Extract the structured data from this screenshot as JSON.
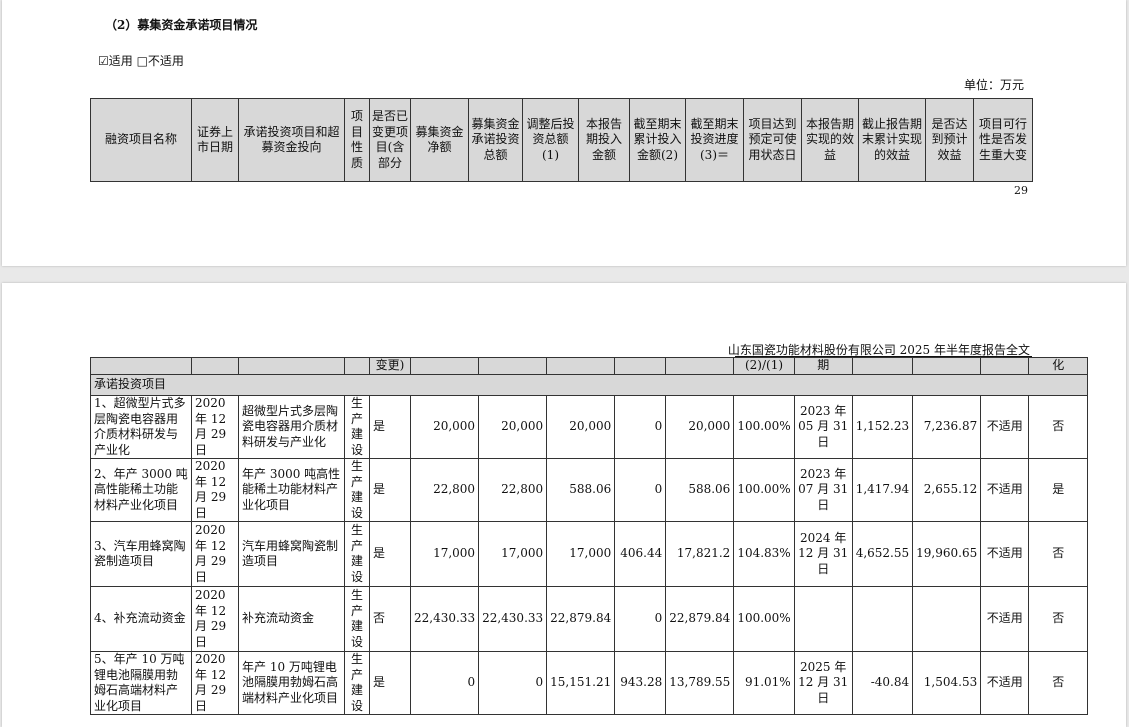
{
  "page1": {
    "section_title": "（2）募集资金承诺项目情况",
    "apply_option": "☑适用 □不适用",
    "unit": "单位：万元",
    "page_number": "29",
    "headers": [
      "融资项目名称",
      "证券上市日期",
      "承诺投资项目和超募资金投向",
      "项目性质",
      "是否已变更项目(含部分",
      "募集资金净额",
      "募集资金承诺投资总额",
      "调整后投资总额(1)",
      "本报告期投入金额",
      "截至期末累计投入金额(2)",
      "截至期末投资进度(3)＝",
      "项目达到预定可使用状态日",
      "本报告期实现的效益",
      "截止报告期末累计实现的效益",
      "是否达到预计效益",
      "项目可行性是否发生重大变"
    ]
  },
  "page2": {
    "report_title": "山东国瓷功能材料股份有限公司 2025 年半年度报告全文",
    "continued": [
      "",
      "",
      "",
      "",
      "变更)",
      "",
      "",
      "",
      "",
      "",
      "(2)/(1)",
      "期",
      "",
      "",
      "",
      "化"
    ],
    "category": "承诺投资项目",
    "rows": [
      {
        "name": "1、超微型片式多层陶瓷电容器用介质材料研发与产业化",
        "date": "2020 年 12 月 29 日",
        "project": "超微型片式多层陶瓷电容器用介质材料研发与产业化",
        "nature": "生产建设",
        "changed": "是",
        "net": "20,000",
        "committed": "20,000",
        "adjusted": "20,000",
        "period": "0",
        "cumulative": "20,000",
        "progress": "100.00%",
        "ready_date": "2023 年 05 月 31 日",
        "benefit": "1,152.23",
        "cum_benefit": "7,236.87",
        "achieved": "不适用",
        "feasibility": "否"
      },
      {
        "name": "2、年产 3000 吨高性能稀土功能材料产业化项目",
        "date": "2020 年 12 月 29 日",
        "project": "年产 3000 吨高性能稀土功能材料产业化项目",
        "nature": "生产建设",
        "changed": "是",
        "net": "22,800",
        "committed": "22,800",
        "adjusted": "588.06",
        "period": "0",
        "cumulative": "588.06",
        "progress": "100.00%",
        "ready_date": "2023 年 07 月 31 日",
        "benefit": "1,417.94",
        "cum_benefit": "2,655.12",
        "achieved": "不适用",
        "feasibility": "是"
      },
      {
        "name": "3、汽车用蜂窝陶瓷制造项目",
        "date": "2020 年 12 月 29 日",
        "project": "汽车用蜂窝陶瓷制造项目",
        "nature": "生产建设",
        "changed": "是",
        "net": "17,000",
        "committed": "17,000",
        "adjusted": "17,000",
        "period": "406.44",
        "cumulative": "17,821.2",
        "progress": "104.83%",
        "ready_date": "2024 年 12 月 31 日",
        "benefit": "4,652.55",
        "cum_benefit": "19,960.65",
        "achieved": "不适用",
        "feasibility": "否"
      },
      {
        "name": "4、补充流动资金",
        "date": "2020 年 12 月 29 日",
        "project": "补充流动资金",
        "nature": "生产建设",
        "changed": "否",
        "net": "22,430.33",
        "committed": "22,430.33",
        "adjusted": "22,879.84",
        "period": "0",
        "cumulative": "22,879.84",
        "progress": "100.00%",
        "ready_date": "",
        "benefit": "",
        "cum_benefit": "",
        "achieved": "不适用",
        "feasibility": "否"
      },
      {
        "name": "5、年产 10 万吨锂电池隔膜用勃姆石高端材料产业化项目",
        "date": "2020 年 12 月 29 日",
        "project": "年产 10 万吨锂电池隔膜用勃姆石高端材料产业化项目",
        "nature": "生产建设",
        "changed": "是",
        "net": "0",
        "committed": "0",
        "adjusted": "15,151.21",
        "period": "943.28",
        "cumulative": "13,789.55",
        "progress": "91.01%",
        "ready_date": "2025 年 12 月 31 日",
        "benefit": "-40.84",
        "cum_benefit": "1,504.53",
        "achieved": "不适用",
        "feasibility": "否"
      }
    ]
  }
}
